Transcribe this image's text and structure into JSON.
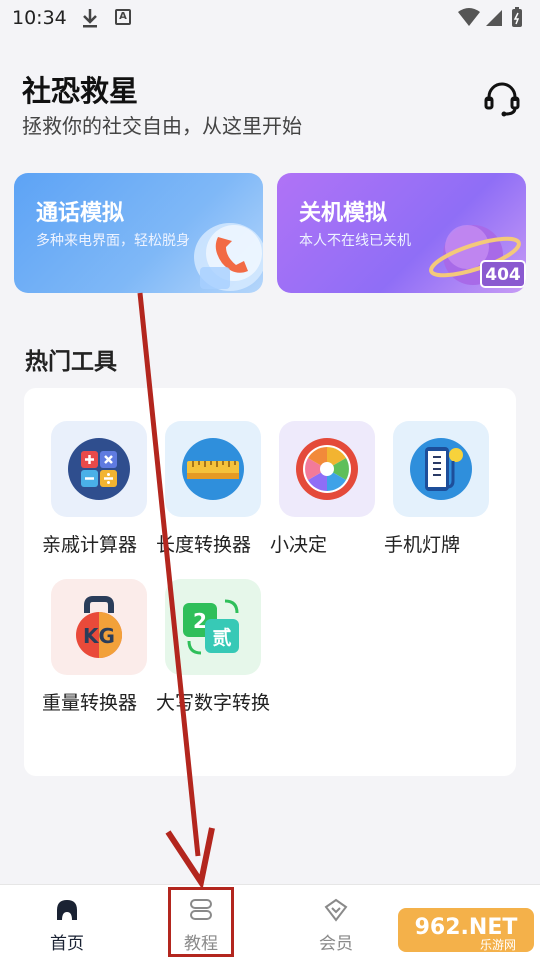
{
  "status_bar": {
    "time": "10:34",
    "badge": "A"
  },
  "header": {
    "title": "社恐救星",
    "subtitle": "拯救你的社交自由，从这里开始"
  },
  "feature_cards": [
    {
      "title": "通话模拟",
      "desc": "多种来电界面，轻松脱身"
    },
    {
      "title": "关机模拟",
      "desc": "本人不在线已关机",
      "art_text": "404"
    }
  ],
  "section": {
    "title": "热门工具"
  },
  "tools": [
    {
      "label": "亲戚计算器",
      "icon": "calculator-icon"
    },
    {
      "label": "长度转换器",
      "icon": "ruler-icon"
    },
    {
      "label": "小决定",
      "icon": "wheel-icon"
    },
    {
      "label": "手机灯牌",
      "icon": "phone-led-icon"
    },
    {
      "label": "重量转换器",
      "icon": "kettlebell-icon",
      "art_text": "KG"
    },
    {
      "label": "大写数字转换",
      "icon": "number-convert-icon",
      "art_a": "2",
      "art_b": "贰"
    }
  ],
  "nav": [
    {
      "label": "首页",
      "active": true
    },
    {
      "label": "教程",
      "active": false
    },
    {
      "label": "会员",
      "active": false
    }
  ],
  "watermark": {
    "text": "962.NET",
    "sub": "乐游网"
  },
  "colors": {
    "accent_red": "#b3261e",
    "active_nav": "#1a2233",
    "inactive_nav": "#8a8a8a"
  }
}
